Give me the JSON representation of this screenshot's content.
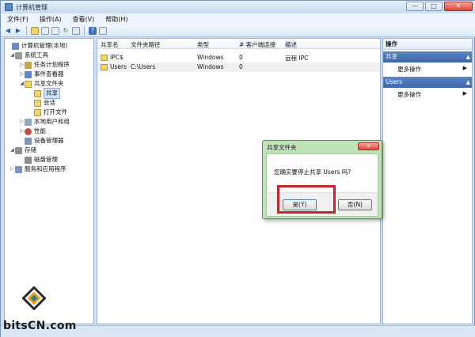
{
  "window": {
    "title": "计算机管理",
    "buttons": {
      "minimize": "—",
      "maximize": "□",
      "close": "✕"
    }
  },
  "menubar": {
    "items": [
      "文件(F)",
      "操作(A)",
      "查看(V)",
      "帮助(H)"
    ]
  },
  "toolbar": {
    "icons": [
      "back-icon",
      "forward-icon",
      "up-folder-icon",
      "show-hide-tree-icon",
      "export-icon",
      "refresh-icon",
      "properties-icon",
      "help-icon",
      "view-icon"
    ]
  },
  "tree": {
    "items": [
      {
        "label": "计算机管理(本地)",
        "expander": "",
        "icon": "computer-icon"
      },
      {
        "label": "系统工具",
        "expander": "◢",
        "icon": "tools-icon"
      },
      {
        "label": "任务计划程序",
        "expander": "▷",
        "icon": "task-scheduler-icon"
      },
      {
        "label": "事件查看器",
        "expander": "▷",
        "icon": "event-viewer-icon"
      },
      {
        "label": "共享文件夹",
        "expander": "◢",
        "icon": "shared-folder-icon"
      },
      {
        "label": "共享",
        "expander": "",
        "icon": "share-icon"
      },
      {
        "label": "会话",
        "expander": "",
        "icon": "sessions-icon"
      },
      {
        "label": "打开文件",
        "expander": "",
        "icon": "open-files-icon"
      },
      {
        "label": "本地用户和组",
        "expander": "▷",
        "icon": "users-icon"
      },
      {
        "label": "性能",
        "expander": "▷",
        "icon": "performance-icon"
      },
      {
        "label": "设备管理器",
        "expander": "",
        "icon": "device-manager-icon"
      },
      {
        "label": "存储",
        "expander": "◢",
        "icon": "storage-icon"
      },
      {
        "label": "磁盘管理",
        "expander": "",
        "icon": "disk-icon"
      },
      {
        "label": "服务和应用程序",
        "expander": "▷",
        "icon": "services-icon"
      }
    ]
  },
  "list": {
    "columns": [
      "共享名",
      "文件夹路径",
      "类型",
      "# 客户端连接",
      "描述"
    ],
    "rows": [
      {
        "name": "IPC$",
        "path": "",
        "type": "Windows",
        "clients": "0",
        "description": "远程 IPC"
      },
      {
        "name": "Users",
        "path": "C:\\Users",
        "type": "Windows",
        "clients": "0",
        "description": ""
      }
    ]
  },
  "actions": {
    "title": "操作",
    "sections": [
      {
        "label": "共享",
        "arrow": "▲",
        "link": "更多操作",
        "link_arrow": "▶"
      },
      {
        "label": "Users",
        "arrow": "▲",
        "link": "更多操作",
        "link_arrow": "▶"
      }
    ]
  },
  "dialog": {
    "title": "共享文件夹",
    "close": "✕",
    "message": "您确实要停止共享 Users 吗?",
    "yes_label": "是(Y)",
    "no_label": "否(N)",
    "highlight_color": "#c4262e"
  },
  "watermark": {
    "text": "bitsCN.com"
  }
}
